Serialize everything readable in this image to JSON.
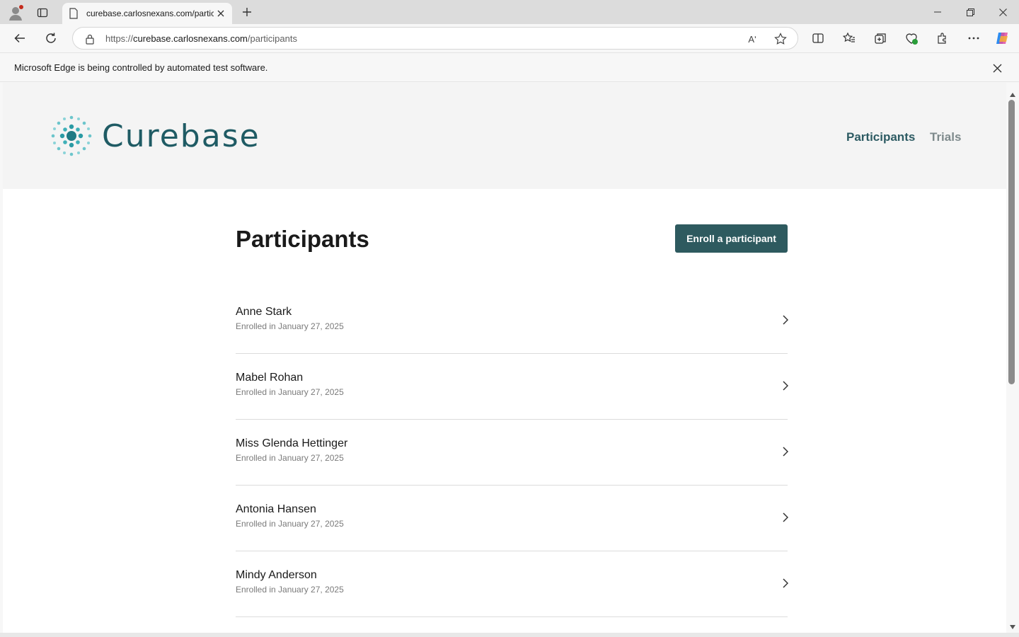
{
  "browser": {
    "tab_title": "curebase.carlosnexans.com/participants",
    "url_prefix": "https://",
    "url_host": "curebase.carlosnexans.com",
    "url_path": "/participants",
    "read_aloud_label": "Aʹ",
    "infobar_message": "Microsoft Edge is being controlled by automated test software."
  },
  "site": {
    "brand": "Curebase",
    "brand_color": "#1f5b64",
    "nav": [
      {
        "label": "Participants",
        "active": true
      },
      {
        "label": "Trials",
        "active": false
      }
    ]
  },
  "page": {
    "title": "Participants",
    "enroll_button": "Enroll a participant",
    "accent": "#2e5a5f"
  },
  "participants": [
    {
      "name": "Anne Stark",
      "enrolled": "Enrolled in January 27, 2025"
    },
    {
      "name": "Mabel Rohan",
      "enrolled": "Enrolled in January 27, 2025"
    },
    {
      "name": "Miss Glenda Hettinger",
      "enrolled": "Enrolled in January 27, 2025"
    },
    {
      "name": "Antonia Hansen",
      "enrolled": "Enrolled in January 27, 2025"
    },
    {
      "name": "Mindy Anderson",
      "enrolled": "Enrolled in January 27, 2025"
    }
  ]
}
